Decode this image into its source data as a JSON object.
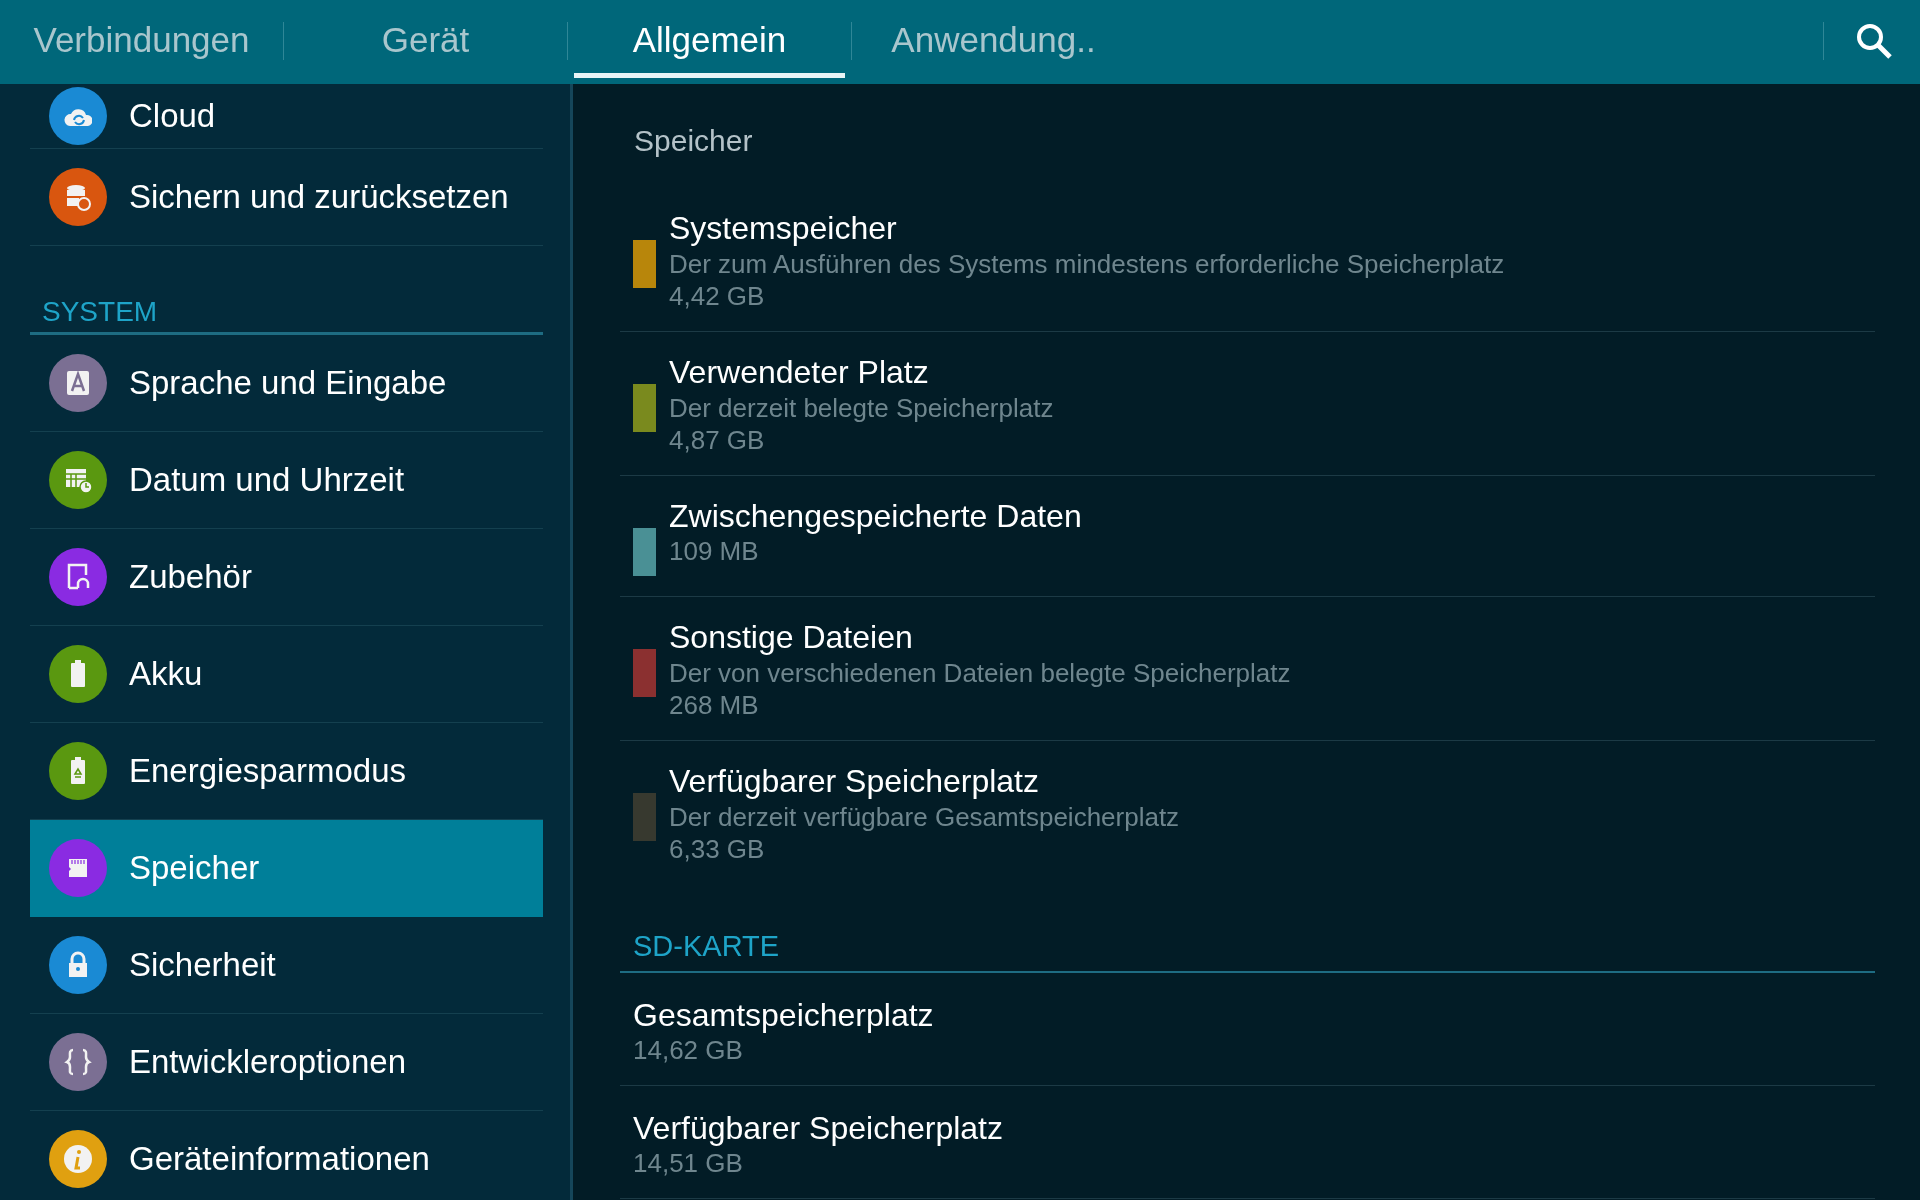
{
  "tabs": [
    {
      "label": "Verbindungen",
      "selected": false
    },
    {
      "label": "Gerät",
      "selected": false
    },
    {
      "label": "Allgemein",
      "selected": true
    },
    {
      "label": "Anwendung..",
      "selected": false
    }
  ],
  "sidebar": {
    "items": [
      {
        "label": "Cloud",
        "selected": false
      },
      {
        "label": "Sichern und zurücksetzen",
        "selected": false
      }
    ],
    "sections": [
      {
        "title": "SYSTEM",
        "items": [
          {
            "label": "Sprache und Eingabe",
            "selected": false
          },
          {
            "label": "Datum und Uhrzeit",
            "selected": false
          },
          {
            "label": "Zubehör",
            "selected": false
          },
          {
            "label": "Akku",
            "selected": false
          },
          {
            "label": "Energiesparmodus",
            "selected": false
          },
          {
            "label": "Speicher",
            "selected": true
          },
          {
            "label": "Sicherheit",
            "selected": false
          },
          {
            "label": "Entwickleroptionen",
            "selected": false
          },
          {
            "label": "Geräteinformationen",
            "selected": false
          }
        ]
      }
    ]
  },
  "content": {
    "title": "Speicher",
    "storage_items": [
      {
        "title": "Systemspeicher",
        "description": "Der zum Ausführen des Systems mindestens erforderliche Speicherplatz",
        "value": "4,42 GB",
        "color": "#b8860b"
      },
      {
        "title": "Verwendeter Platz",
        "description": "Der derzeit belegte Speicherplatz",
        "value": "4,87 GB",
        "color": "#7a8a1e"
      },
      {
        "title": "Zwischengespeicherte Daten",
        "value": "109 MB",
        "color": "#4a9095"
      },
      {
        "title": "Sonstige Dateien",
        "description": "Der von verschiedenen Dateien belegte Speicherplatz",
        "value": "268 MB",
        "color": "#8b3030"
      },
      {
        "title": "Verfügbarer Speicherplatz",
        "description": "Der derzeit verfügbare Gesamtspeicherplatz",
        "value": "6,33 GB",
        "color": "#37392f"
      }
    ],
    "sd_card": {
      "title": "SD-KARTE",
      "items": [
        {
          "title": "Gesamtspeicherplatz",
          "value": "14,62 GB"
        },
        {
          "title": "Verfügbarer Speicherplatz",
          "value": "14,51 GB"
        }
      ]
    }
  }
}
